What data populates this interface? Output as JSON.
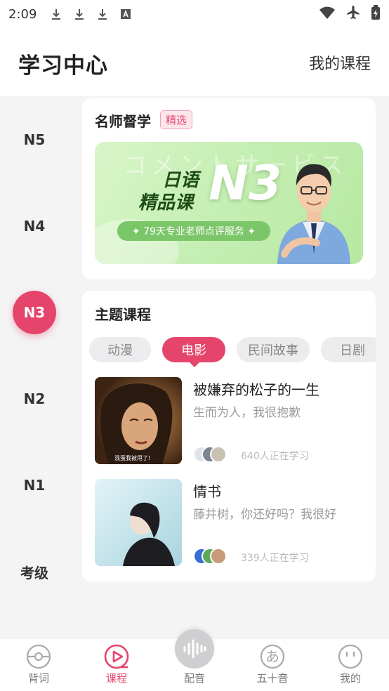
{
  "status_bar": {
    "time": "2:09",
    "icons": [
      "download-icon",
      "download-icon",
      "download-icon",
      "font-icon"
    ],
    "right_icons": [
      "wifi-icon",
      "airplane-mode-icon",
      "battery-charging-icon"
    ]
  },
  "header": {
    "title": "学习中心",
    "my_courses": "我的课程"
  },
  "levels": [
    {
      "label": "N5",
      "active": false
    },
    {
      "label": "N4",
      "active": false
    },
    {
      "label": "N3",
      "active": true
    },
    {
      "label": "N2",
      "active": false
    },
    {
      "label": "N1",
      "active": false
    },
    {
      "label": "考级",
      "active": false
    }
  ],
  "featured": {
    "title": "名师督学",
    "tag": "精选",
    "banner": {
      "ghost_text": "コメントサービス",
      "line1": "日语",
      "line2": "精品课",
      "level": "N3",
      "pill": "✦ 79天专业老师点评服务 ✦"
    }
  },
  "topics": {
    "title": "主题课程",
    "tabs": [
      "动漫",
      "电影",
      "民间故事",
      "日剧"
    ],
    "active_tab": "电影",
    "courses": [
      {
        "title": "被嫌弃的松子的一生",
        "subtitle": "生而为人，我很抱歉",
        "learners": "640人正在学习",
        "thumb_caption": "混蛋我被甩了!"
      },
      {
        "title": "情书",
        "subtitle": "藤井树，你还好吗？我很好",
        "learners": "339人正在学习"
      }
    ]
  },
  "bottom_nav": [
    {
      "label": "背词",
      "icon": "pokeball-icon",
      "active": false
    },
    {
      "label": "课程",
      "icon": "play-circle-icon",
      "active": true
    },
    {
      "label": "配音",
      "icon": "soundwave-icon",
      "active": false
    },
    {
      "label": "五十音",
      "icon": "hiragana-a-icon",
      "active": false
    },
    {
      "label": "我的",
      "icon": "smiley-face-icon",
      "active": false
    }
  ],
  "colors": {
    "accent": "#e6456b",
    "banner_green": "#c6efb4"
  }
}
